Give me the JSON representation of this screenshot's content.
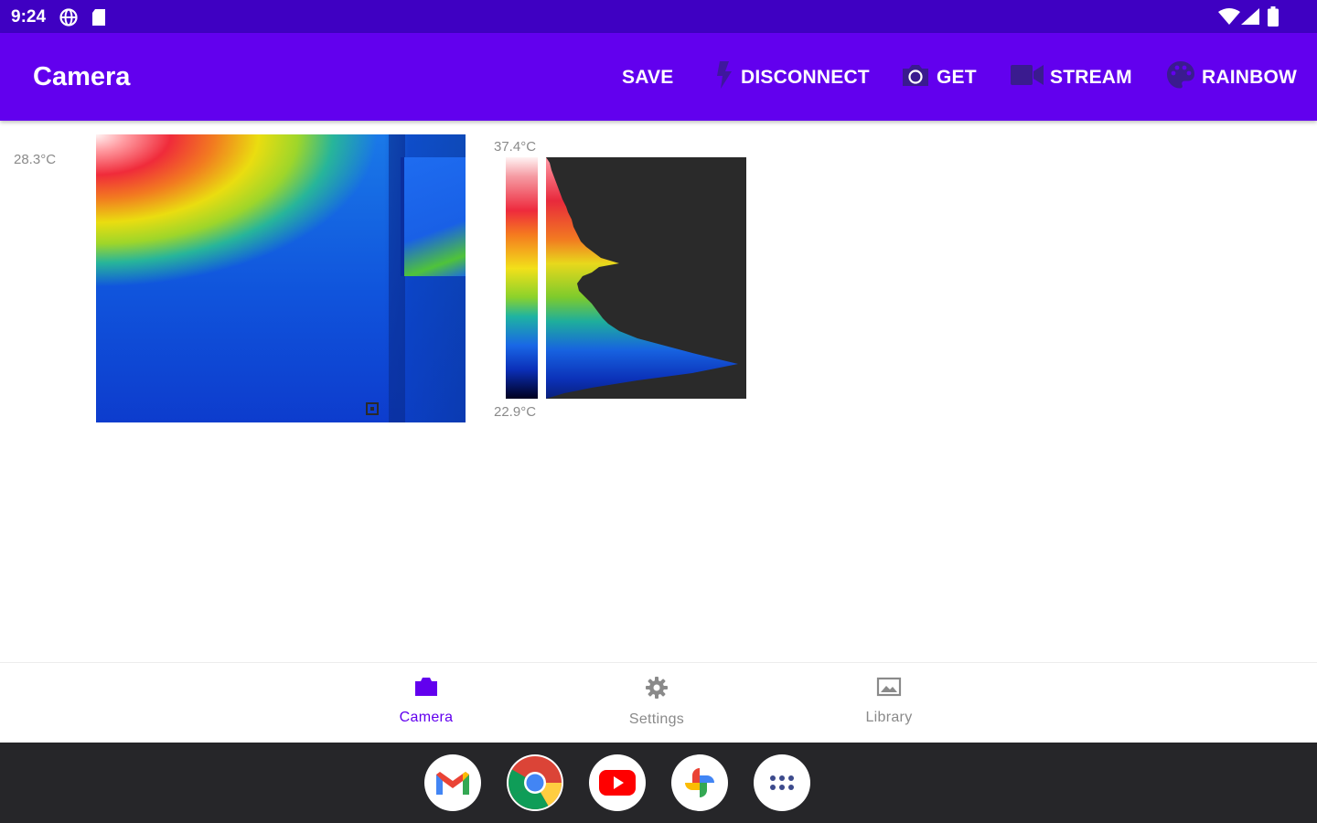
{
  "status_bar": {
    "time": "9:24"
  },
  "app_bar": {
    "title": "Camera",
    "actions": {
      "save": "SAVE",
      "disconnect": "DISCONNECT",
      "get": "GET",
      "stream": "STREAM",
      "palette": "RAINBOW"
    }
  },
  "thermal_view": {
    "spot_temperature": "28.3°C",
    "scale_max": "37.4°C",
    "scale_min": "22.9°C"
  },
  "bottom_nav": {
    "items": [
      {
        "label": "Camera",
        "icon": "camera-icon",
        "selected": true
      },
      {
        "label": "Settings",
        "icon": "gear-icon",
        "selected": false
      },
      {
        "label": "Library",
        "icon": "image-icon",
        "selected": false
      }
    ]
  },
  "taskbar": {
    "apps": [
      "gmail-icon",
      "chrome-icon",
      "youtube-icon",
      "photos-icon",
      "app-drawer-icon"
    ]
  },
  "colors": {
    "status_bar": "#3f00c2",
    "app_bar": "#6200ee",
    "nav_selected": "#6200ee",
    "nav_unselected": "#8a8a8a",
    "taskbar": "#262629"
  }
}
